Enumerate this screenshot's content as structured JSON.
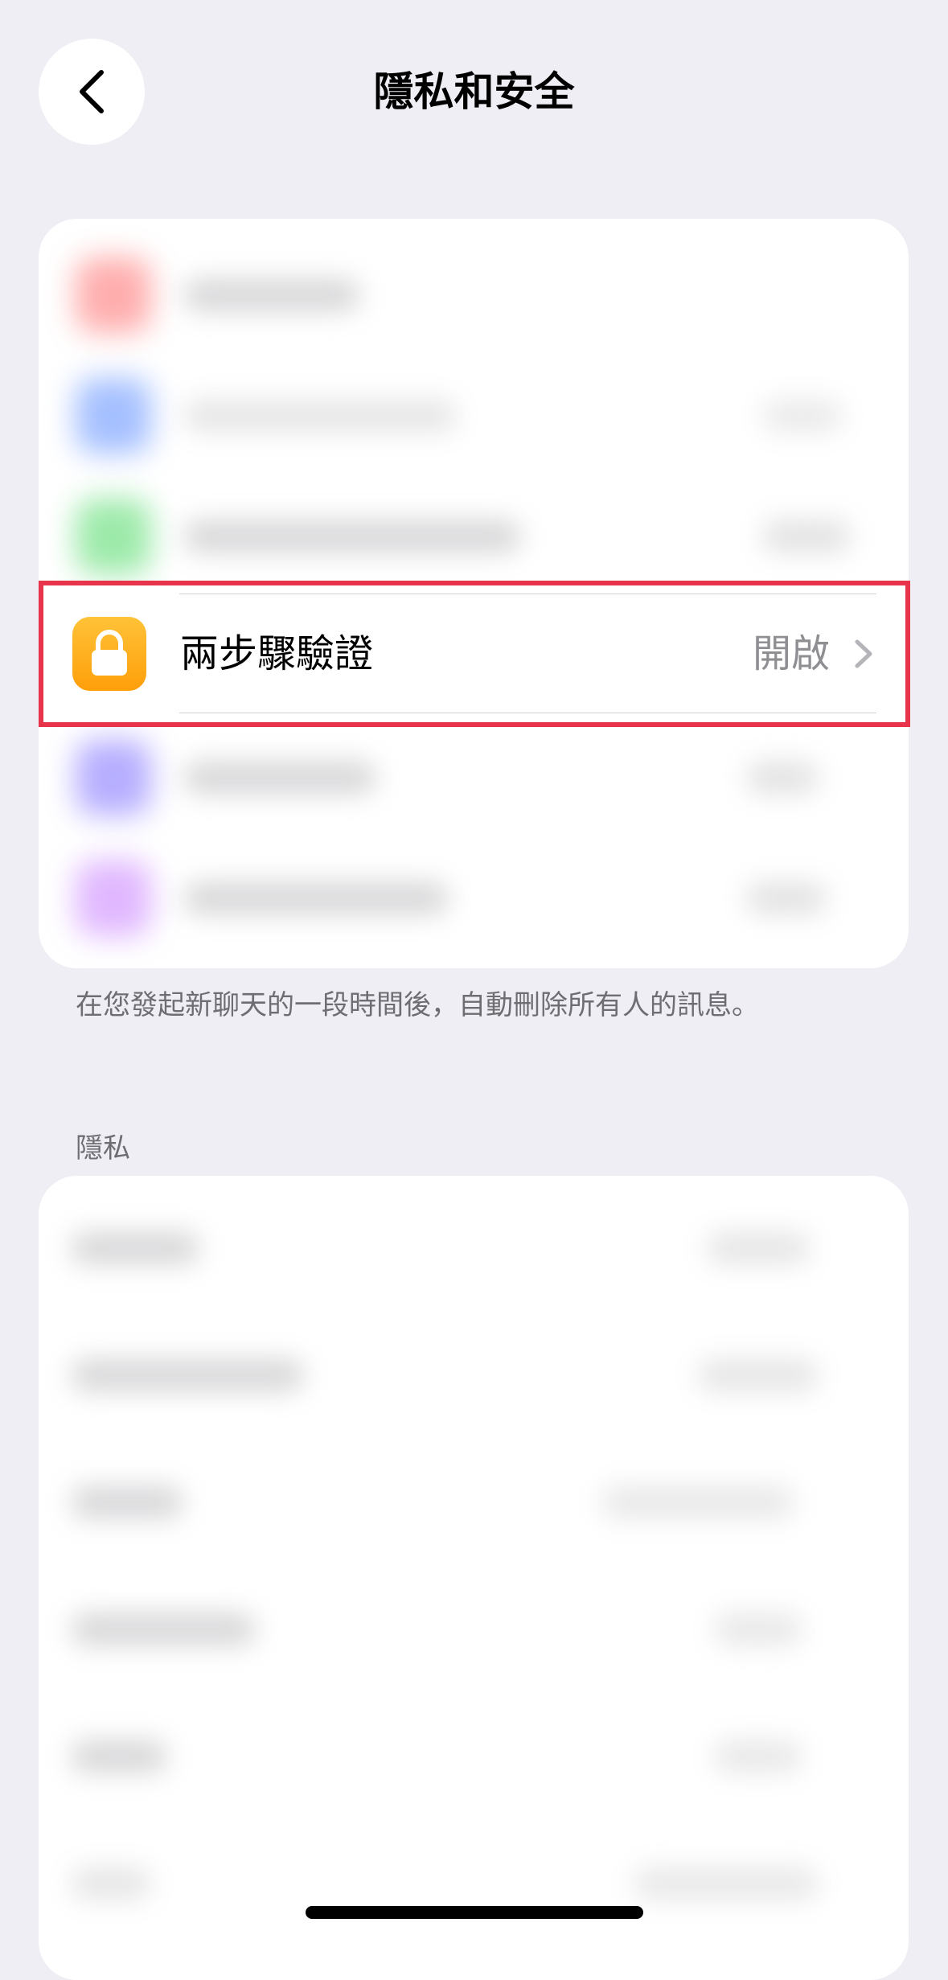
{
  "header": {
    "title": "隱私和安全",
    "back_icon": "chevron-left-icon"
  },
  "security_card": {
    "highlighted_row": {
      "icon": "lock-icon",
      "icon_color": "#ff9f0a",
      "label": "兩步驟驗證",
      "value": "開啟"
    },
    "highlight_color": "#e8344a",
    "footer": "在您發起新聊天的一段時間後，自動刪除所有人的訊息。"
  },
  "privacy_section": {
    "header": "隱私"
  }
}
